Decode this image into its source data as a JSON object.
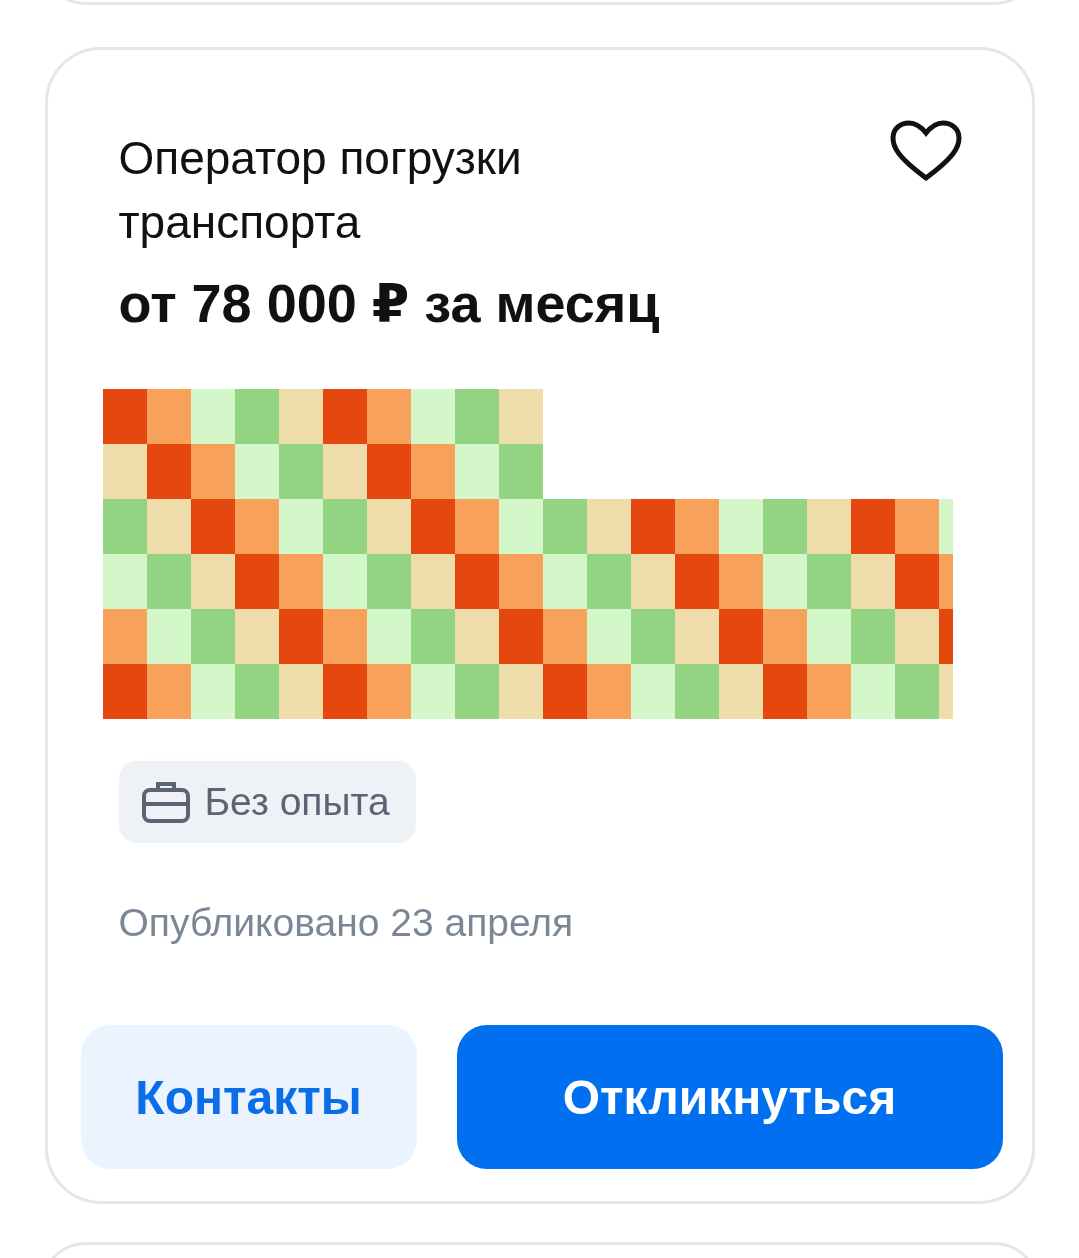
{
  "vacancy": {
    "title": "Оператор погрузки транспорта",
    "salary": "от 78 000 ₽ за месяц",
    "favorite": false,
    "tags": [
      {
        "kind": "experience",
        "label": "Без опыта"
      }
    ],
    "published": "Опубликовано 23 апреля",
    "buttons": [
      {
        "kind": "secondary",
        "label": "Контакты"
      },
      {
        "kind": "primary",
        "label": "Откликнуться"
      }
    ]
  }
}
